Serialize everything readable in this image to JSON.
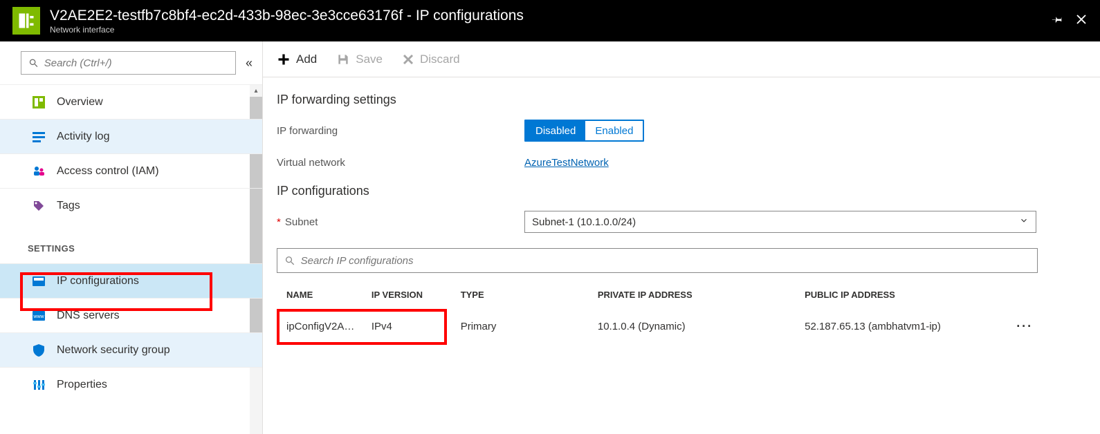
{
  "header": {
    "title": "V2AE2E2-testfb7c8bf4-ec2d-433b-98ec-3e3cce63176f - IP configurations",
    "subtitle": "Network interface"
  },
  "sidebar": {
    "search_placeholder": "Search (Ctrl+/)",
    "items_top": [
      {
        "label": "Overview",
        "key": "overview"
      },
      {
        "label": "Activity log",
        "key": "activity-log"
      },
      {
        "label": "Access control (IAM)",
        "key": "access-control"
      },
      {
        "label": "Tags",
        "key": "tags"
      }
    ],
    "section_label": "SETTINGS",
    "items_settings": [
      {
        "label": "IP configurations",
        "key": "ip-configurations"
      },
      {
        "label": "DNS servers",
        "key": "dns-servers"
      },
      {
        "label": "Network security group",
        "key": "nsg"
      },
      {
        "label": "Properties",
        "key": "properties"
      }
    ]
  },
  "toolbar": {
    "add": "Add",
    "save": "Save",
    "discard": "Discard"
  },
  "forwarding": {
    "section_title": "IP forwarding settings",
    "label": "IP forwarding",
    "disabled": "Disabled",
    "enabled": "Enabled",
    "vnet_label": "Virtual network",
    "vnet_value": "AzureTestNetwork"
  },
  "ipconfig": {
    "section_title": "IP configurations",
    "subnet_label": "Subnet",
    "subnet_value": "Subnet-1 (10.1.0.0/24)",
    "search_placeholder": "Search IP configurations",
    "columns": {
      "name": "NAME",
      "version": "IP VERSION",
      "type": "TYPE",
      "private": "PRIVATE IP ADDRESS",
      "public": "PUBLIC IP ADDRESS"
    },
    "rows": [
      {
        "name": "ipConfigV2A…",
        "version": "IPv4",
        "type": "Primary",
        "private": "10.1.0.4 (Dynamic)",
        "public": "52.187.65.13 (ambhatvm1-ip)"
      }
    ]
  }
}
